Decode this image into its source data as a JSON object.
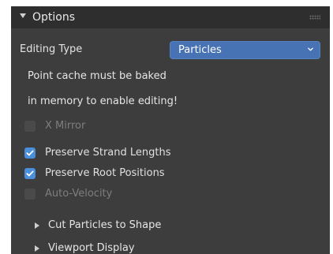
{
  "panel": {
    "title": "Options",
    "expanded": true
  },
  "editing_type": {
    "label": "Editing Type",
    "value": "Particles"
  },
  "message": {
    "line1": "Point cache must be baked",
    "line2": "in memory to enable editing!"
  },
  "checkboxes": [
    {
      "label": "X Mirror",
      "checked": false,
      "enabled": false
    },
    {
      "label": "Preserve Strand Lengths",
      "checked": true,
      "enabled": true
    },
    {
      "label": "Preserve Root Positions",
      "checked": true,
      "enabled": true
    },
    {
      "label": "Auto-Velocity",
      "checked": false,
      "enabled": false
    }
  ],
  "subpanels": [
    {
      "label": "Cut Particles to Shape",
      "expanded": false
    },
    {
      "label": "Viewport Display",
      "expanded": false
    }
  ],
  "colors": {
    "panel_bg": "#3d3d3d",
    "header_bg": "#2e2e2e",
    "dropdown_bg": "#4772b3",
    "checkbox_on": "#4a8fd9",
    "disabled_text": "#7e7e7e"
  },
  "icons": {
    "header_toggle": "triangle-down-icon",
    "drag_handle": "grip-dots-icon",
    "dropdown": "chevron-down-icon",
    "check": "checkmark-icon",
    "subpanel_toggle": "triangle-right-icon"
  }
}
